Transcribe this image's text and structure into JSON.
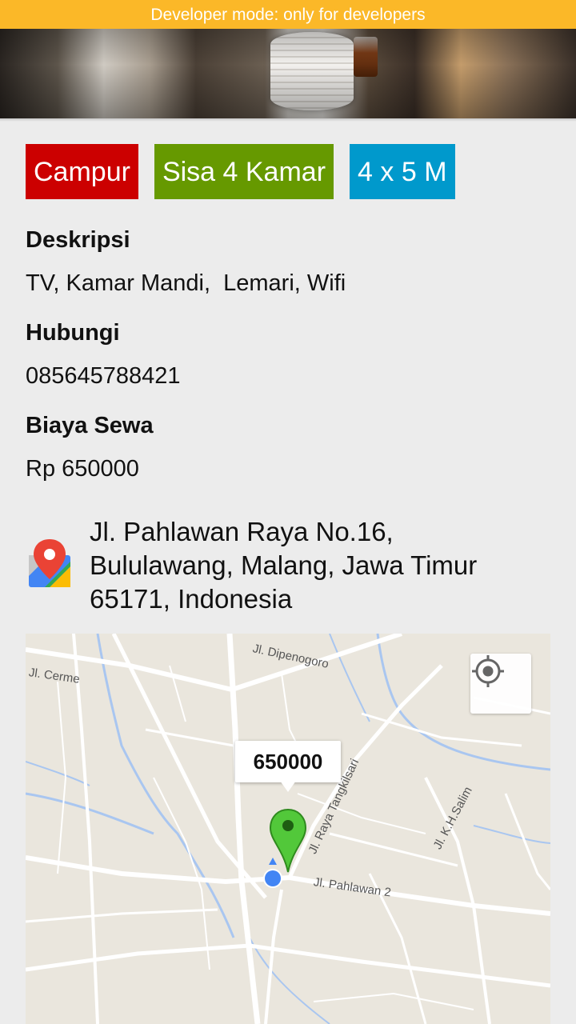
{
  "banner": {
    "text": "Developer mode: only for developers"
  },
  "tags": [
    {
      "label": "Campur",
      "color": "#cc0000"
    },
    {
      "label": "Sisa 4 Kamar",
      "color": "#669900"
    },
    {
      "label": "4 x 5 M",
      "color": "#0099cc"
    }
  ],
  "details": {
    "description_label": "Deskripsi",
    "description_value": "TV, Kamar Mandi,  Lemari, Wifi",
    "contact_label": "Hubungi",
    "contact_value": "085645788421",
    "price_label": "Biaya Sewa",
    "price_value": "Rp 650000"
  },
  "address": {
    "icon": "map-pin-icon",
    "line1": "Jl. Pahlawan Raya No.16,",
    "line2": "Bululawang, Malang, Jawa Timur",
    "line3": "65171, Indonesia"
  },
  "map": {
    "marker_label": "650000",
    "marker_color": "#52c83a",
    "my_location_color": "#4285f4",
    "streets": [
      "Jl. Dipenogoro",
      "Jl. Cerme",
      "Jl. Raya Tangkilsari",
      "Jl. K.H.Salim",
      "Jl. Pahlawan 2"
    ]
  }
}
